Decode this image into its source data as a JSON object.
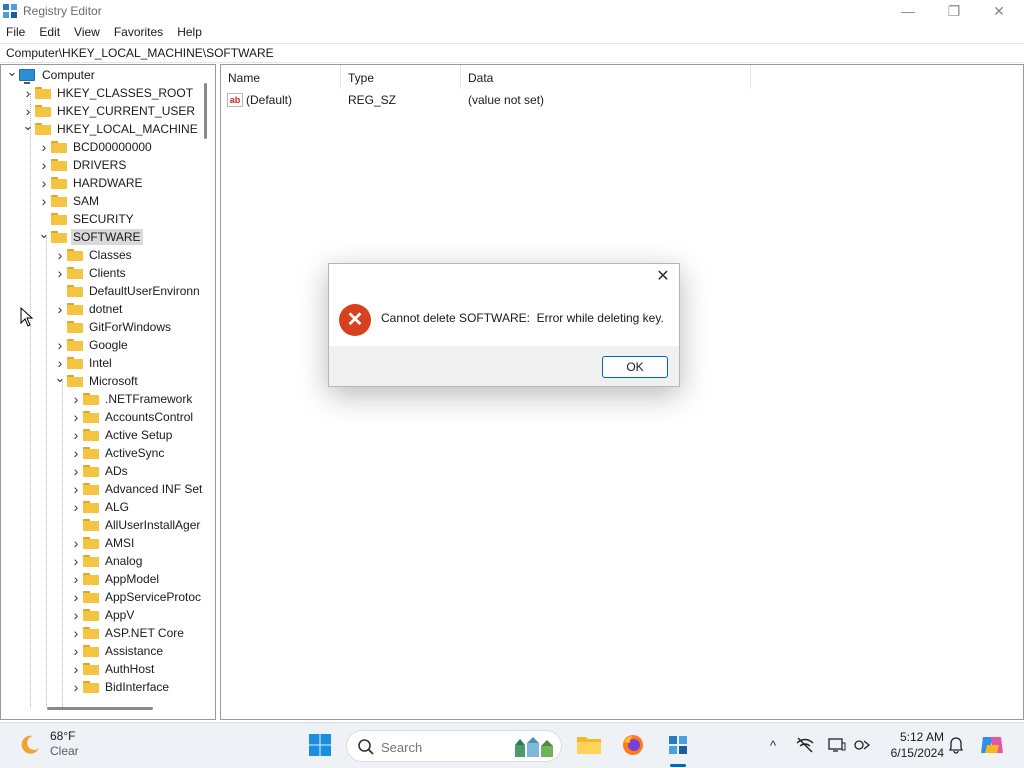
{
  "window": {
    "title": "Registry Editor",
    "controls": {
      "minimize": "—",
      "restore": "❐",
      "close": "✕"
    }
  },
  "menu": [
    "File",
    "Edit",
    "View",
    "Favorites",
    "Help"
  ],
  "address": "Computer\\HKEY_LOCAL_MACHINE\\SOFTWARE",
  "tree": [
    {
      "label": "Computer",
      "depth": 0,
      "state": "expanded",
      "icon": "computer-icon"
    },
    {
      "label": "HKEY_CLASSES_ROOT",
      "depth": 1,
      "state": "collapsed"
    },
    {
      "label": "HKEY_CURRENT_USER",
      "depth": 1,
      "state": "collapsed"
    },
    {
      "label": "HKEY_LOCAL_MACHINE",
      "depth": 1,
      "state": "expanded"
    },
    {
      "label": "BCD00000000",
      "depth": 2,
      "state": "collapsed"
    },
    {
      "label": "DRIVERS",
      "depth": 2,
      "state": "collapsed"
    },
    {
      "label": "HARDWARE",
      "depth": 2,
      "state": "collapsed"
    },
    {
      "label": "SAM",
      "depth": 2,
      "state": "collapsed"
    },
    {
      "label": "SECURITY",
      "depth": 2,
      "state": "leaf"
    },
    {
      "label": "SOFTWARE",
      "depth": 2,
      "state": "expanded",
      "selected": true
    },
    {
      "label": "Classes",
      "depth": 3,
      "state": "collapsed"
    },
    {
      "label": "Clients",
      "depth": 3,
      "state": "collapsed"
    },
    {
      "label": "DefaultUserEnvironn",
      "depth": 3,
      "state": "leaf"
    },
    {
      "label": "dotnet",
      "depth": 3,
      "state": "collapsed"
    },
    {
      "label": "GitForWindows",
      "depth": 3,
      "state": "leaf"
    },
    {
      "label": "Google",
      "depth": 3,
      "state": "collapsed"
    },
    {
      "label": "Intel",
      "depth": 3,
      "state": "collapsed"
    },
    {
      "label": "Microsoft",
      "depth": 3,
      "state": "expanded"
    },
    {
      "label": ".NETFramework",
      "depth": 4,
      "state": "collapsed"
    },
    {
      "label": "AccountsControl",
      "depth": 4,
      "state": "collapsed"
    },
    {
      "label": "Active Setup",
      "depth": 4,
      "state": "collapsed"
    },
    {
      "label": "ActiveSync",
      "depth": 4,
      "state": "collapsed"
    },
    {
      "label": "ADs",
      "depth": 4,
      "state": "collapsed"
    },
    {
      "label": "Advanced INF Set",
      "depth": 4,
      "state": "collapsed"
    },
    {
      "label": "ALG",
      "depth": 4,
      "state": "collapsed"
    },
    {
      "label": "AllUserInstallAger",
      "depth": 4,
      "state": "leaf"
    },
    {
      "label": "AMSI",
      "depth": 4,
      "state": "collapsed"
    },
    {
      "label": "Analog",
      "depth": 4,
      "state": "collapsed"
    },
    {
      "label": "AppModel",
      "depth": 4,
      "state": "collapsed"
    },
    {
      "label": "AppServiceProtoc",
      "depth": 4,
      "state": "collapsed"
    },
    {
      "label": "AppV",
      "depth": 4,
      "state": "collapsed"
    },
    {
      "label": "ASP.NET Core",
      "depth": 4,
      "state": "collapsed"
    },
    {
      "label": "Assistance",
      "depth": 4,
      "state": "collapsed"
    },
    {
      "label": "AuthHost",
      "depth": 4,
      "state": "collapsed"
    },
    {
      "label": "BidInterface",
      "depth": 4,
      "state": "collapsed"
    }
  ],
  "list": {
    "columns": [
      "Name",
      "Type",
      "Data"
    ],
    "rows": [
      {
        "name": "(Default)",
        "type": "REG_SZ",
        "data": "(value not set)",
        "icon": "ab"
      }
    ]
  },
  "dialog": {
    "message": "Cannot delete SOFTWARE:  Error while deleting key.",
    "ok_label": "OK",
    "close_glyph": "✕",
    "error_glyph": "✕"
  },
  "taskbar": {
    "weather": {
      "temp": "68°F",
      "condition": "Clear"
    },
    "search_placeholder": "Search",
    "clock": {
      "time": "5:12 AM",
      "date": "6/15/2024"
    },
    "tray": {
      "chevron": "^"
    }
  },
  "colors": {
    "accent": "#0067c0",
    "folder": "#f5c542",
    "error": "#d8411f",
    "selection": "#d9d9d9"
  }
}
